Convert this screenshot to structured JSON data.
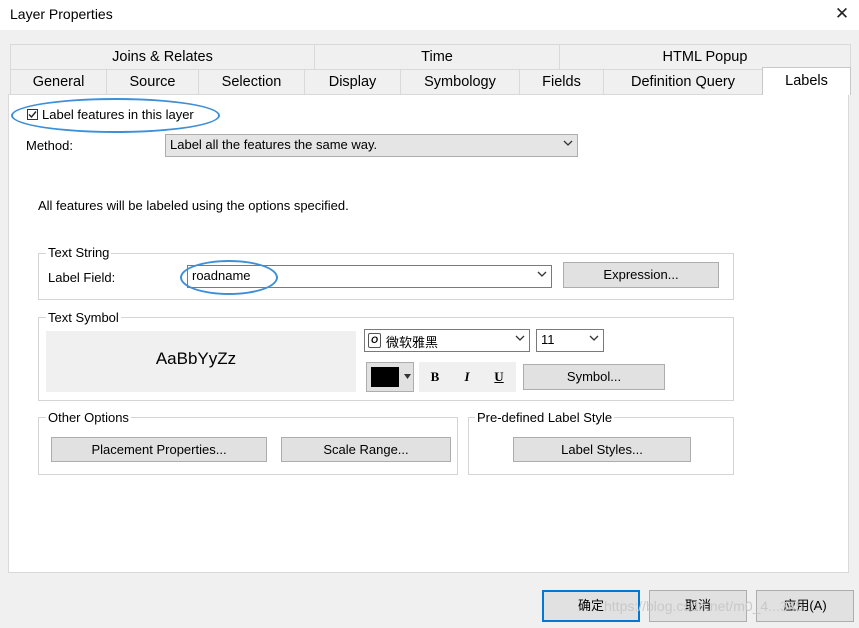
{
  "window": {
    "title": "Layer Properties"
  },
  "tabs": {
    "row1": [
      "Joins & Relates",
      "Time",
      "HTML Popup"
    ],
    "row2": [
      "General",
      "Source",
      "Selection",
      "Display",
      "Symbology",
      "Fields",
      "Definition Query",
      "Labels"
    ]
  },
  "labels_tab": {
    "label_checkbox": {
      "label": "Label features in this layer",
      "checked": true
    },
    "method": {
      "label": "Method:",
      "value": "Label all the features the same way."
    },
    "description": "All features will be labeled using the options specified.",
    "text_string": {
      "group_label": "Text String",
      "field_label": "Label Field:",
      "field_value": "roadname",
      "expression_button": "Expression..."
    },
    "text_symbol": {
      "group_label": "Text Symbol",
      "preview_text": "AaBbYyZz",
      "font_value": "微软雅黑",
      "size_value": "11",
      "bold": "B",
      "italic": "I",
      "underline": "U",
      "symbol_button": "Symbol...",
      "color": "#000000"
    },
    "other_options": {
      "group_label": "Other Options",
      "placement_button": "Placement Properties...",
      "scale_button": "Scale Range..."
    },
    "predefined": {
      "group_label": "Pre-defined Label Style",
      "styles_button": "Label Styles..."
    }
  },
  "footer": {
    "ok": "确定",
    "cancel": "取消",
    "apply": "应用(A)",
    "watermark": "https://blog.csdn.net/m0_4...345"
  },
  "colors": {
    "highlight_ellipse": "#3d8fd8",
    "default_button_border": "#0078d7"
  }
}
